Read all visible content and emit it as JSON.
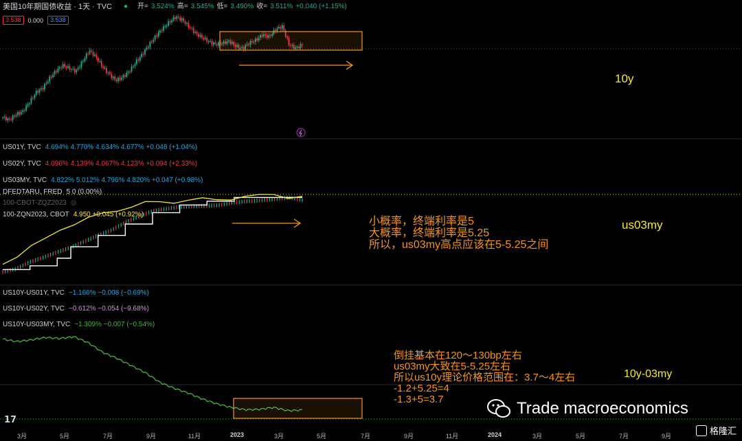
{
  "header": {
    "title": "美国10年期国债收益 · 1天 · TVC",
    "ohlc": [
      {
        "label": "开=",
        "value": "3.524%"
      },
      {
        "label": "高=",
        "value": "3.545%"
      },
      {
        "label": "低=",
        "value": "3.490%"
      },
      {
        "label": "收=",
        "value": "3.511%"
      }
    ],
    "change": "+0.040 (+1.15%)",
    "bid": "3.538",
    "spread": "0.000",
    "ask": "3.538"
  },
  "panes": {
    "us01y": {
      "name": "US01Y, TVC",
      "values": "4.694% 4.770% 4.634% 4.677% +0.048 (+1.04%)"
    },
    "us02y": {
      "name": "US02Y, TVC",
      "values": "4.096% 4.139% 4.067% 4.123% +0.094 (+2.33%)"
    },
    "us03my": {
      "name": "US03MY, TVC",
      "values": "4.822% 5.012% 4.796% 4.820% +0.047 (+0.98%)"
    },
    "dfedtaru": {
      "name": "DFEDTARU, FRED",
      "values": "5 0 (0.00%)"
    },
    "cbot_zqz": {
      "name": "100-CBOT-ZQZ2023"
    },
    "zqn": {
      "name": "100-ZQN2023, CBOT",
      "values": "4.950 +0.045 (+0.92%)"
    },
    "s1": {
      "name": "US10Y-US01Y, TVC",
      "values": "−1.166% −0.008 (−0.69%)"
    },
    "s2": {
      "name": "US10Y-US02Y, TVC",
      "values": "−0.612% −0.054 (−9.68%)"
    },
    "s3": {
      "name": "US10Y-US03MY, TVC",
      "values": "−1.309% −0.007 (−0.54%)"
    }
  },
  "annotations": {
    "label_10y": "10y",
    "label_us03my": "us03my",
    "label_spread": "10y-03my",
    "mid_text": [
      "小概率，终端利率是5",
      "大概率，终端利率是5.25",
      "所以，us03my高点应该在5-5.25之间"
    ],
    "bottom_text": [
      "倒挂基本在120～130bp左右",
      "us03my大致在5-5.25左右",
      "所以us10y理论价格范围在：3.7～4左右",
      "-1.2+5.25=4",
      "-1.3+5=3.7"
    ]
  },
  "time_axis": [
    "3月",
    "5月",
    "7月",
    "9月",
    "11月",
    "2023",
    "3月",
    "5月",
    "7月",
    "9月",
    "11月",
    "2024",
    "3月",
    "5月",
    "7月",
    "9月"
  ],
  "watermark": "Trade macroeconomics",
  "brand": "格隆汇",
  "colors": {
    "up": "#22ab94",
    "down": "#f23645",
    "orange": "#f7941d",
    "yellow": "#f5e63a",
    "green": "#49b53c",
    "white": "#ffffff"
  },
  "chart_data": [
    {
      "type": "candlestick",
      "title": "美国10年期国债收益 · 1天 · TVC",
      "series": [
        {
          "name": "US10Y",
          "values": [
            1.78,
            1.72,
            1.85,
            1.92,
            2.14,
            2.38,
            2.48,
            2.71,
            2.89,
            3.02,
            2.95,
            2.88,
            3.12,
            3.38,
            3.22,
            2.98,
            2.81,
            2.66,
            2.74,
            2.88,
            3.1,
            3.29,
            3.52,
            3.72,
            3.9,
            4.05,
            4.18,
            4.1,
            3.94,
            3.78,
            3.68,
            3.58,
            3.52,
            3.55,
            3.6,
            3.48,
            3.42,
            3.55,
            3.62,
            3.75,
            3.7,
            3.88,
            3.95,
            3.52,
            3.43,
            3.51
          ]
        }
      ],
      "last": 3.511
    },
    {
      "type": "line",
      "series": [
        {
          "name": "US03MY, TVC",
          "values": [
            0.1,
            0.3,
            0.75,
            1.05,
            1.4,
            1.7,
            2.1,
            2.5,
            2.85,
            3.35,
            3.75,
            4.1,
            4.25,
            4.38,
            4.42,
            4.45,
            4.5,
            4.68,
            4.75,
            4.82,
            4.88,
            5.0,
            4.82
          ]
        },
        {
          "name": "DFEDTARU, FRED",
          "values": [
            0.25,
            0.25,
            0.5,
            0.5,
            1.0,
            1.75,
            1.75,
            2.5,
            2.5,
            3.25,
            3.25,
            4.0,
            4.0,
            4.5,
            4.5,
            4.75,
            4.75,
            5.0,
            5.0,
            5.0,
            5.0,
            5.0,
            5.0
          ]
        }
      ]
    },
    {
      "type": "line",
      "series": [
        {
          "name": "US10Y-US03MY, TVC",
          "values": [
            1.65,
            1.55,
            1.62,
            1.72,
            1.68,
            1.75,
            1.5,
            1.1,
            0.85,
            0.55,
            0.25,
            -0.15,
            -0.4,
            -0.6,
            -0.85,
            -1.05,
            -1.2,
            -1.3,
            -1.28,
            -1.2,
            -1.34,
            -1.31
          ]
        }
      ]
    }
  ]
}
